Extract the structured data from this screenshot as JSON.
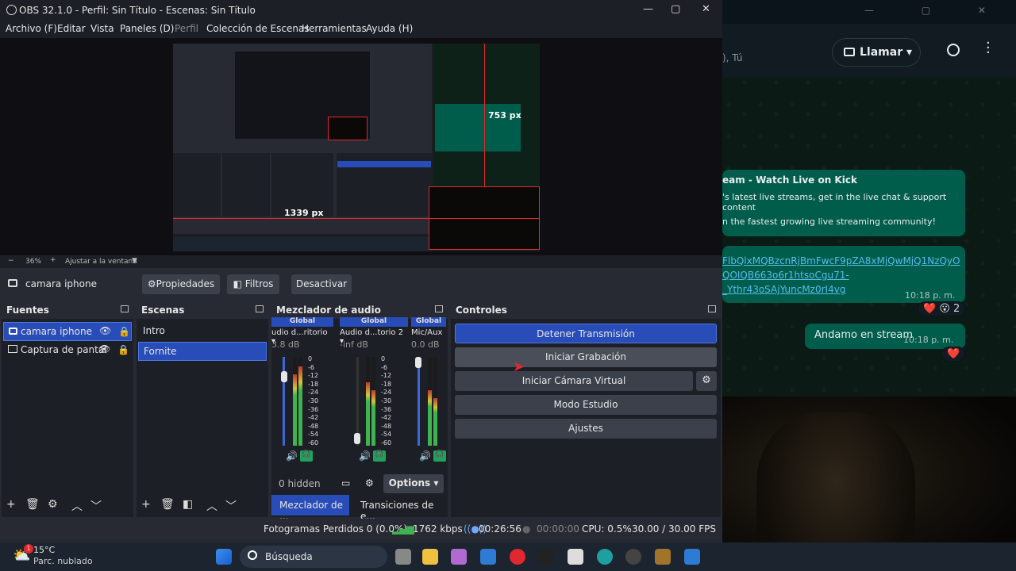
{
  "obs": {
    "title": "OBS 32.1.0 - Perfil: Sin Título - Escenas: Sin Título",
    "menu": [
      "Archivo (F)",
      "Editar",
      "Vista",
      "Paneles (D)",
      "Perfil",
      "Colección de Escenas",
      "Herramientas",
      "Ayuda (H)"
    ],
    "preview_labels": {
      "width_label": "1339 px",
      "height_label": "753 px"
    },
    "zoom": {
      "level": "36%",
      "fit": "Ajustar a la ventana"
    },
    "source_bar": {
      "name": "camara iphone",
      "props": "Propiedades",
      "filters": "Filtros",
      "deactivate": "Desactivar"
    },
    "sources": {
      "title": "Fuentes",
      "items": [
        "camara iphone",
        "Captura de pantal"
      ]
    },
    "scenes": {
      "title": "Escenas",
      "items": [
        "Intro",
        "Fornite"
      ]
    },
    "mixer": {
      "title": "Mezclador de audio",
      "channels": [
        {
          "group": "Global",
          "name": "udio d...ritorio",
          "db": "3.8 dB"
        },
        {
          "group": "Global",
          "name": "Audio d...torio 2",
          "db": "-inf dB"
        },
        {
          "group": "Global",
          "name": "Mic/Aux",
          "db": "0.0 dB"
        }
      ],
      "scale": [
        "0",
        "-6",
        "-12",
        "-18",
        "-24",
        "-30",
        "-36",
        "-42",
        "-48",
        "-54",
        "-60"
      ],
      "hidden": "0 hidden",
      "options": "Options",
      "tabs": [
        "Mezclador de ...",
        "Transiciones de e..."
      ]
    },
    "controls": {
      "title": "Controles",
      "stop_stream": "Detener Transmisión",
      "start_rec": "Iniciar Grabación",
      "virtual_cam": "Iniciar Cámara Virtual",
      "studio": "Modo Estudio",
      "settings": "Ajustes"
    },
    "status": {
      "dropped": "Fotogramas Perdidos 0 (0.0%)",
      "kbps": "1762 kbps",
      "stream_time": "00:26:56",
      "rec_time": "00:00:00",
      "cpu": "CPU: 0.5%",
      "fps": "30.00 / 30.00 FPS"
    }
  },
  "whatsapp": {
    "you": "), Tú",
    "call": "Llamar",
    "msg1_title": "eam - Watch Live on Kick",
    "msg1_body1": "'s latest live streams, get in the live chat & support content",
    "msg1_body2": "n the fastest growing live streaming community!",
    "msg2_link1": "FlbQlxMQBzcnRjBmFwcF9pZA8xMjQwMjQ1NzQyO",
    "msg2_link2": "QOIQB663o6r1htsoCgu71-",
    "msg2_link3": "_Ythr43oSAjYuncMz0rI4vg",
    "msg2_time": "10:18 p. m.",
    "msg2_reactions": "❤️ 😮 2",
    "msg3_text": "Andamo en stream",
    "msg3_time": "10:18 p. m.",
    "msg3_reaction": "❤️"
  },
  "taskbar": {
    "temp": "15°C",
    "weather": "Parc. nublado",
    "badge": "1",
    "search": "Búsqueda"
  }
}
